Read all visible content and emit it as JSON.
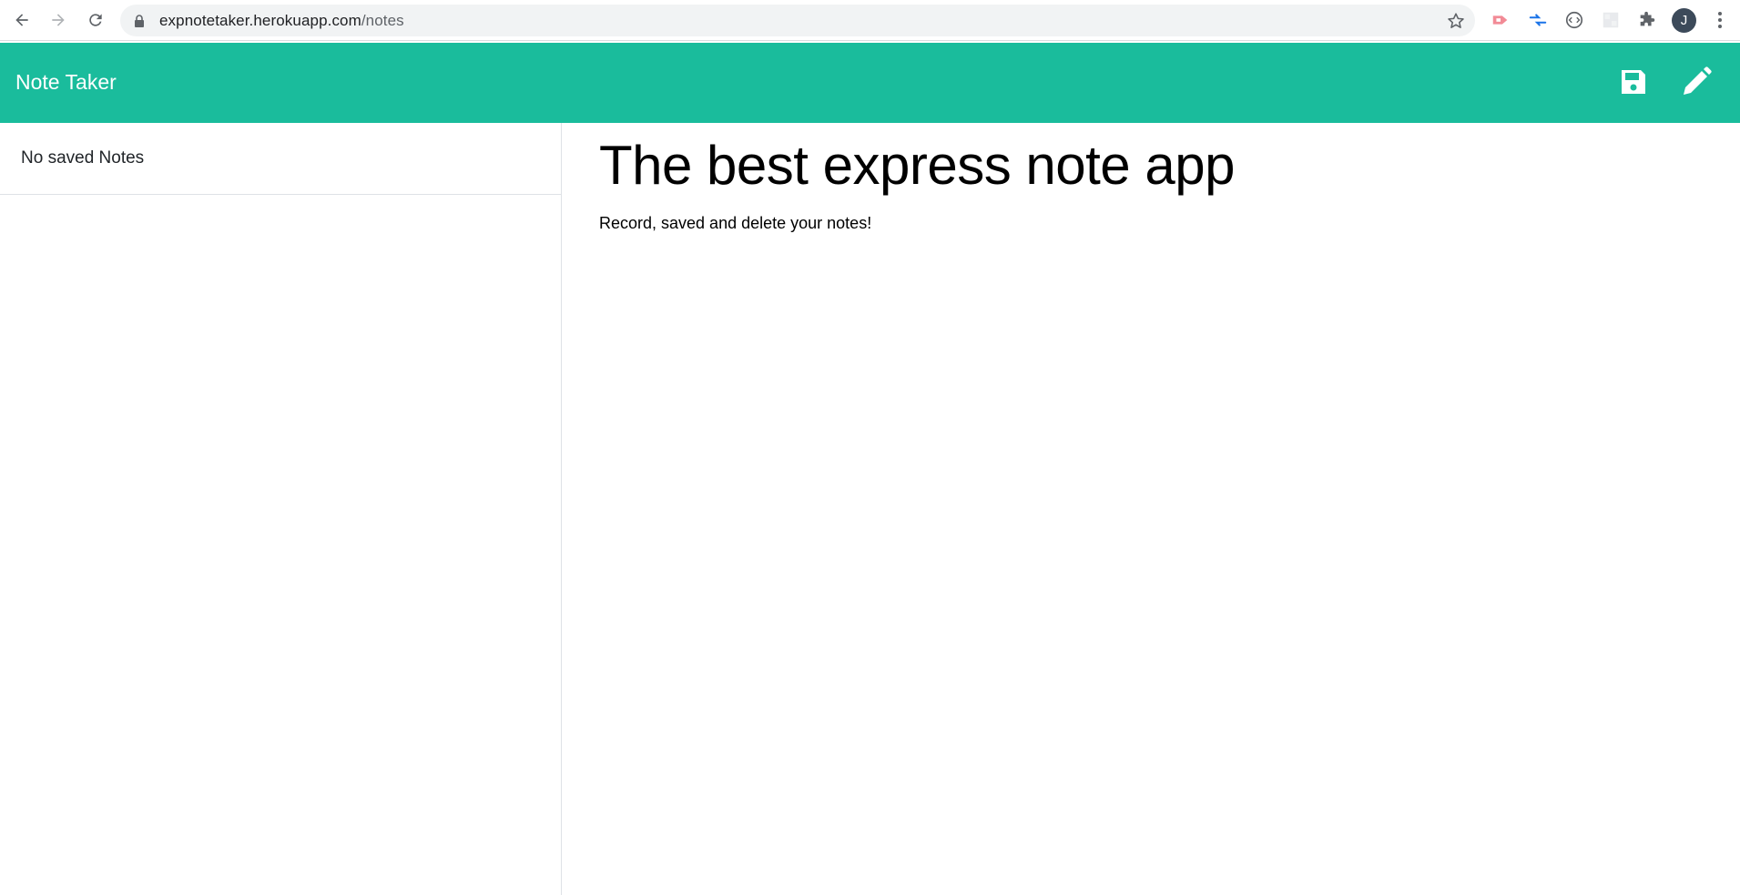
{
  "browser": {
    "url_host": "expnotetaker.herokuapp.com",
    "url_path": "/notes",
    "profile_initial": "J"
  },
  "app": {
    "brand": "Note Taker",
    "accent_color": "#1abc9c",
    "nav_icons": [
      "save-icon",
      "pencil-icon"
    ]
  },
  "sidebar": {
    "empty_message": "No saved Notes"
  },
  "main": {
    "title": "The best express note app",
    "subtitle": "Record, saved and delete your notes!"
  }
}
